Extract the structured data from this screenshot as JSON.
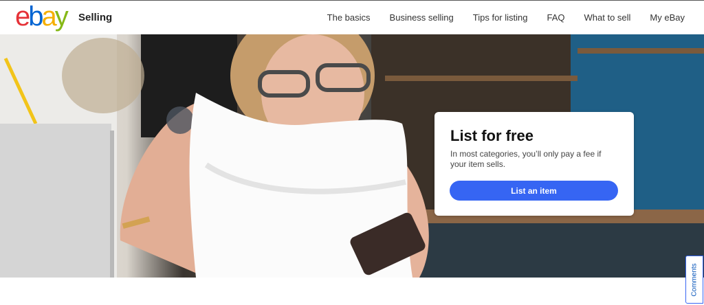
{
  "header": {
    "logo_letters": [
      "e",
      "b",
      "a",
      "y"
    ],
    "section_label": "Selling",
    "nav": [
      {
        "label": "The basics"
      },
      {
        "label": "Business selling"
      },
      {
        "label": "Tips for listing"
      },
      {
        "label": "FAQ"
      },
      {
        "label": "What to sell"
      },
      {
        "label": "My eBay"
      }
    ]
  },
  "hero": {
    "image_description_icon": "hero-photo",
    "promo": {
      "title": "List for free",
      "text": "In most categories, you’ll only pay a fee if your item sells.",
      "button_label": "List an item"
    }
  },
  "feedback": {
    "tab_label": "Comments"
  },
  "colors": {
    "logo_e": "#e53238",
    "logo_b": "#0064d2",
    "logo_a": "#f5af02",
    "logo_y": "#86b817",
    "accent": "#3665f3"
  }
}
